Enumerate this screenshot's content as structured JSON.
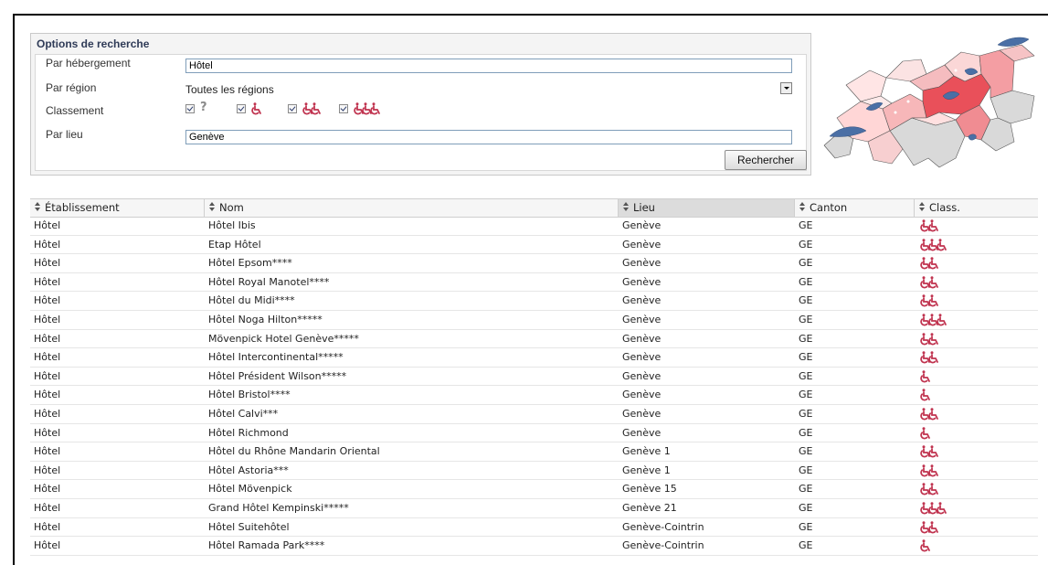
{
  "search": {
    "title": "Options de recherche",
    "accommodation_label": "Par hébergement",
    "accommodation_value": "Hôtel",
    "region_label": "Par région",
    "region_value": "Toutes les régions",
    "rating_label": "Classement",
    "rating_options": [
      {
        "icon": "question-mark-icon",
        "checked": true
      },
      {
        "icon": "wheelchair-one-icon",
        "checked": true
      },
      {
        "icon": "wheelchair-two-icon",
        "checked": true
      },
      {
        "icon": "wheelchair-three-icon",
        "checked": true
      }
    ],
    "place_label": "Par lieu",
    "place_value": "Genève",
    "submit_label": "Rechercher"
  },
  "map": {
    "icon": "switzerland-canton-map",
    "colors": {
      "light": "#ffd6d6",
      "medium": "#f7a7a9",
      "dark": "#e9505a",
      "grey": "#d9d9d9",
      "lake": "#4a6fa5"
    }
  },
  "table": {
    "columns": [
      "Établissement",
      "Nom",
      "Lieu",
      "Canton",
      "Class."
    ],
    "sorted_column": "Lieu",
    "rows": [
      {
        "type": "Hôtel",
        "name": "Hôtel Ibis",
        "place": "Genève",
        "canton": "GE",
        "rating": 2
      },
      {
        "type": "Hôtel",
        "name": "Etap Hôtel",
        "place": "Genève",
        "canton": "GE",
        "rating": 3
      },
      {
        "type": "Hôtel",
        "name": "Hôtel Epsom****",
        "place": "Genève",
        "canton": "GE",
        "rating": 2
      },
      {
        "type": "Hôtel",
        "name": "Hôtel Royal Manotel****",
        "place": "Genève",
        "canton": "GE",
        "rating": 2
      },
      {
        "type": "Hôtel",
        "name": "Hôtel du Midi****",
        "place": "Genève",
        "canton": "GE",
        "rating": 2
      },
      {
        "type": "Hôtel",
        "name": "Hôtel Noga Hilton*****",
        "place": "Genève",
        "canton": "GE",
        "rating": 3
      },
      {
        "type": "Hôtel",
        "name": "Mövenpick Hotel Genève*****",
        "place": "Genève",
        "canton": "GE",
        "rating": 2
      },
      {
        "type": "Hôtel",
        "name": "Hôtel Intercontinental*****",
        "place": "Genève",
        "canton": "GE",
        "rating": 2
      },
      {
        "type": "Hôtel",
        "name": "Hôtel Président Wilson*****",
        "place": "Genève",
        "canton": "GE",
        "rating": 1
      },
      {
        "type": "Hôtel",
        "name": "Hôtel Bristol****",
        "place": "Genève",
        "canton": "GE",
        "rating": 1
      },
      {
        "type": "Hôtel",
        "name": "Hôtel Calvi***",
        "place": "Genève",
        "canton": "GE",
        "rating": 2
      },
      {
        "type": "Hôtel",
        "name": "Hôtel Richmond",
        "place": "Genève",
        "canton": "GE",
        "rating": 1
      },
      {
        "type": "Hôtel",
        "name": "Hôtel du Rhône Mandarin Oriental",
        "place": "Genève 1",
        "canton": "GE",
        "rating": 2
      },
      {
        "type": "Hôtel",
        "name": "Hôtel Astoria***",
        "place": "Genève 1",
        "canton": "GE",
        "rating": 2
      },
      {
        "type": "Hôtel",
        "name": "Hôtel Mövenpick",
        "place": "Genève 15",
        "canton": "GE",
        "rating": 2
      },
      {
        "type": "Hôtel",
        "name": "Grand Hôtel Kempinski*****",
        "place": "Genève 21",
        "canton": "GE",
        "rating": 3
      },
      {
        "type": "Hôtel",
        "name": "Hôtel Suitehôtel",
        "place": "Genève-Cointrin",
        "canton": "GE",
        "rating": 2
      },
      {
        "type": "Hôtel",
        "name": "Hôtel Ramada Park****",
        "place": "Genève-Cointrin",
        "canton": "GE",
        "rating": 1
      }
    ]
  },
  "icon_color": "#c0334f"
}
